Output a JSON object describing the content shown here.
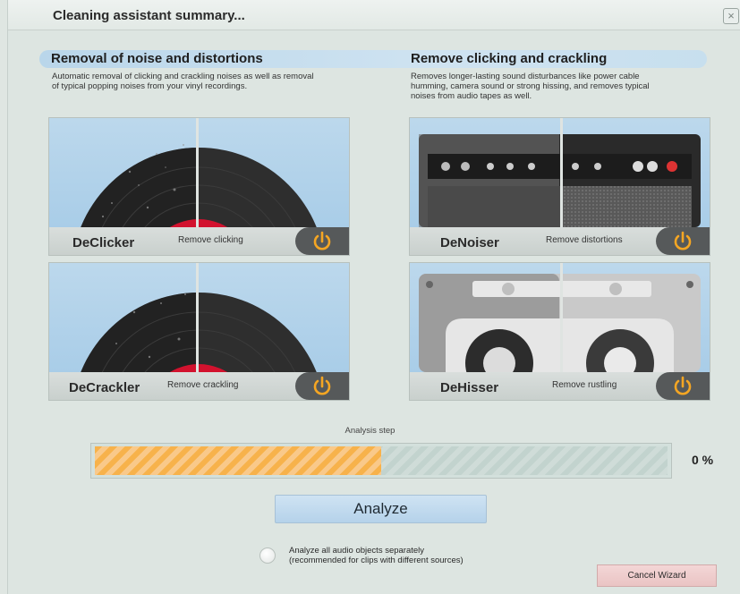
{
  "window": {
    "title": "Cleaning assistant summary...",
    "close_icon": "×"
  },
  "sections": [
    {
      "title": "Removal of noise and distortions",
      "desc_line1": "Automatic removal of clicking and crackling noises as well as removal",
      "desc_line2": "of typical popping noises from your vinyl recordings."
    },
    {
      "title": "Remove clicking and crackling",
      "desc_line1": "Removes longer-lasting sound disturbances like power cable",
      "desc_line2": "humming, camera sound or strong hissing, and removes typical",
      "desc_line3": "noises from audio tapes as well."
    }
  ],
  "modules": [
    {
      "name": "DeClicker",
      "desc": "Remove clicking",
      "icon": "vinyl-record"
    },
    {
      "name": "DeNoiser",
      "desc": "Remove distortions",
      "icon": "amplifier"
    },
    {
      "name": "DeCrackler",
      "desc": "Remove crackling",
      "icon": "vinyl-record"
    },
    {
      "name": "DeHisser",
      "desc": "Remove rustling",
      "icon": "cassette-tape"
    }
  ],
  "analysis": {
    "label": "Analysis step",
    "percent_text": "0 %",
    "fill_fraction": 0.5
  },
  "analyze_label": "Analyze",
  "option": {
    "line1": "Analyze all audio objects separately",
    "line2": "(recommended for clips with different sources)"
  },
  "cancel_label": "Cancel Wizard",
  "colors": {
    "accent_orange": "#f7b24b",
    "power_orange": "#f5a623",
    "record_red": "#d2122e"
  }
}
